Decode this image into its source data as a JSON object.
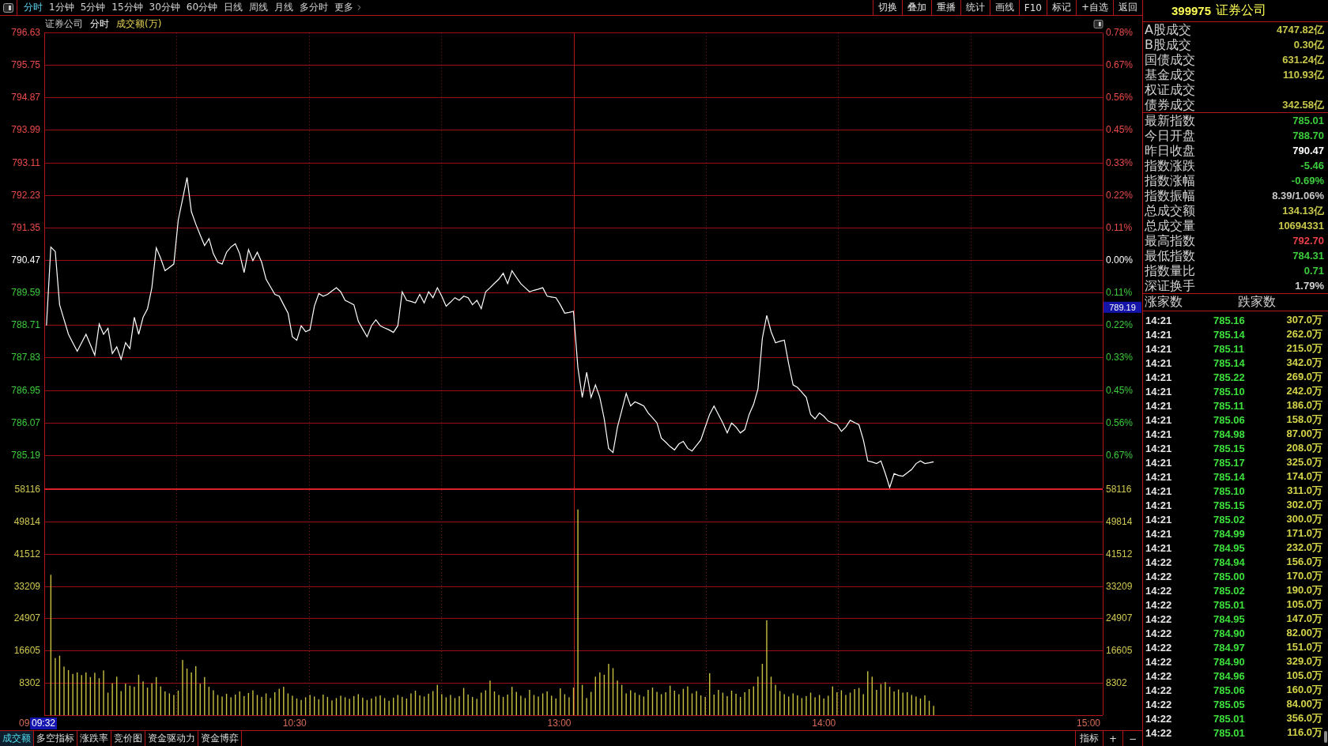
{
  "toolbar": {
    "periods": [
      {
        "label": "分时",
        "selected": true,
        "kind": "period"
      },
      {
        "label": "1分钟",
        "selected": false,
        "kind": "period"
      },
      {
        "label": "5分钟",
        "selected": false,
        "kind": "period"
      },
      {
        "label": "15分钟",
        "selected": false,
        "kind": "period"
      },
      {
        "label": "30分钟",
        "selected": false,
        "kind": "period"
      },
      {
        "label": "60分钟",
        "selected": false,
        "kind": "period"
      },
      {
        "label": "日线",
        "selected": false,
        "kind": "period"
      },
      {
        "label": "周线",
        "selected": false,
        "kind": "period"
      },
      {
        "label": "月线",
        "selected": false,
        "kind": "period"
      },
      {
        "label": "多分时",
        "selected": false,
        "kind": "period"
      },
      {
        "label": "更多",
        "selected": false,
        "kind": "more"
      }
    ],
    "tools": [
      "切换",
      "叠加",
      "重播",
      "统计",
      "画线",
      "F10",
      "标记",
      "+自选",
      "返回"
    ]
  },
  "chart_header": {
    "security": "证券公司",
    "period": "分时",
    "indicator": "成交额(万)"
  },
  "price_chart": {
    "chart_data": {
      "type": "line",
      "grid": true,
      "categories": [
        null,
        null,
        null,
        null,
        null,
        null,
        null,
        null,
        null,
        null,
        null,
        null,
        null,
        null,
        null,
        null,
        null,
        null,
        null,
        null,
        null,
        null,
        null,
        null,
        null,
        null,
        null,
        null,
        null,
        null,
        null,
        null,
        null,
        null,
        null,
        null,
        null,
        null,
        null,
        null,
        null,
        null,
        null,
        null,
        null,
        null,
        null,
        null,
        null,
        null,
        null,
        null,
        null,
        null,
        null,
        null,
        null,
        null,
        null,
        null,
        null,
        null,
        null,
        null,
        null,
        null,
        null,
        null,
        null,
        null,
        null,
        null,
        null,
        null,
        null,
        null,
        null,
        null,
        null,
        null,
        null,
        null,
        null,
        null,
        null,
        null,
        null,
        null,
        null,
        null,
        null,
        null,
        null,
        null,
        null,
        null,
        null,
        null,
        null,
        null,
        null,
        null,
        null,
        null,
        null,
        null,
        null,
        null,
        null,
        null,
        null,
        null,
        null,
        null,
        null,
        null,
        null,
        null,
        null,
        null,
        null,
        null,
        null,
        null,
        null,
        null,
        null,
        null,
        null,
        null,
        null,
        null,
        null,
        null,
        null,
        null,
        null,
        null,
        null,
        null,
        null,
        null,
        null,
        null,
        null,
        null,
        null,
        null,
        null,
        null,
        null,
        null,
        null,
        null,
        null,
        null,
        null,
        null,
        null,
        null,
        null,
        null,
        null,
        null,
        null,
        null,
        null,
        null,
        null,
        null,
        null,
        null,
        null,
        null,
        null,
        null,
        null,
        null,
        null,
        null,
        null,
        null,
        null,
        null,
        null,
        null,
        null,
        null,
        null,
        null,
        null,
        null,
        null,
        null,
        null,
        null,
        null,
        null,
        null,
        null,
        null,
        null,
        null,
        null,
        null,
        null,
        null,
        null,
        null,
        null,
        null,
        null,
        null,
        null,
        null,
        null,
        null,
        null,
        null,
        null,
        null,
        null,
        null,
        null,
        null,
        null,
        null,
        null,
        null,
        null,
        null,
        null,
        null,
        null,
        null,
        null,
        null,
        null,
        null,
        null,
        null
      ],
      "series": [
        {
          "color": "#ffffff",
          "values": [
            788.7,
            790.82,
            790.7,
            789.26,
            788.86,
            788.46,
            788.23,
            788.0,
            788.23,
            788.46,
            788.18,
            787.89,
            788.74,
            788.46,
            788.62,
            787.94,
            788.12,
            787.78,
            788.23,
            788.07,
            788.92,
            788.46,
            788.92,
            789.15,
            789.72,
            790.8,
            790.52,
            790.18,
            790.27,
            790.36,
            791.55,
            792.12,
            792.7,
            791.78,
            791.44,
            791.15,
            790.86,
            791.05,
            790.64,
            790.41,
            790.36,
            790.68,
            790.82,
            790.91,
            790.64,
            790.13,
            790.75,
            790.45,
            790.68,
            790.41,
            789.95,
            789.75,
            789.54,
            789.49,
            789.26,
            789.03,
            788.39,
            788.3,
            788.69,
            788.53,
            788.58,
            789.22,
            789.56,
            789.49,
            789.54,
            789.63,
            789.72,
            789.61,
            789.38,
            789.32,
            789.26,
            788.81,
            788.6,
            788.39,
            788.69,
            788.85,
            788.69,
            788.63,
            788.58,
            788.51,
            788.69,
            789.61,
            789.38,
            789.35,
            789.31,
            789.54,
            789.31,
            789.61,
            789.45,
            789.72,
            789.49,
            789.22,
            789.33,
            789.45,
            789.38,
            789.49,
            789.45,
            789.26,
            789.38,
            789.15,
            789.61,
            789.72,
            789.84,
            789.95,
            790.11,
            789.83,
            790.18,
            790.0,
            789.83,
            789.72,
            789.61,
            789.65,
            789.68,
            789.72,
            789.49,
            789.47,
            789.45,
            789.26,
            789.03,
            789.05,
            789.08,
            787.55,
            786.75,
            787.43,
            786.75,
            787.09,
            786.75,
            786.17,
            785.37,
            785.26,
            785.95,
            786.4,
            786.86,
            786.52,
            786.63,
            786.58,
            786.52,
            786.33,
            786.2,
            786.06,
            785.65,
            785.54,
            785.42,
            785.33,
            785.49,
            785.56,
            785.37,
            785.3,
            785.45,
            785.6,
            785.95,
            786.29,
            786.52,
            786.29,
            786.06,
            785.79,
            786.06,
            785.95,
            785.79,
            785.88,
            786.29,
            786.56,
            786.98,
            788.35,
            788.97,
            788.53,
            788.23,
            788.27,
            788.3,
            787.66,
            787.09,
            787.02,
            786.89,
            786.75,
            786.29,
            786.17,
            786.33,
            786.24,
            786.11,
            786.06,
            786.01,
            785.83,
            785.95,
            786.13,
            786.07,
            786.01,
            785.6,
            785.03,
            785.0,
            784.96,
            785.03,
            784.69,
            784.31,
            784.69,
            784.64,
            784.62,
            784.71,
            784.8,
            784.96,
            785.03,
            784.96,
            784.98,
            785.01,
            null,
            null,
            null,
            null,
            null,
            null,
            null,
            null,
            null,
            null,
            null,
            null,
            null,
            null,
            null,
            null,
            null,
            null,
            null,
            null,
            null,
            null,
            null,
            null,
            null,
            null,
            null,
            null,
            null,
            null,
            null,
            null,
            null,
            null,
            null,
            null,
            null,
            null
          ]
        }
      ],
      "ylim": [
        784.31,
        796.63
      ],
      "yticks": [
        {
          "value": 796.63,
          "label": "796.63"
        },
        {
          "value": 795.75,
          "label": "795.75"
        },
        {
          "value": 794.87,
          "label": "794.87"
        },
        {
          "value": 793.99,
          "label": "793.99"
        },
        {
          "value": 793.11,
          "label": "793.11"
        },
        {
          "value": 792.23,
          "label": "792.23"
        },
        {
          "value": 791.35,
          "label": "791.35"
        },
        {
          "value": 790.47,
          "label": "790.47"
        },
        {
          "value": 789.59,
          "label": "789.59"
        },
        {
          "value": 788.71,
          "label": "788.71"
        },
        {
          "value": 787.83,
          "label": "787.83"
        },
        {
          "value": 786.95,
          "label": "786.95"
        },
        {
          "value": 786.07,
          "label": "786.07"
        },
        {
          "value": 785.19,
          "label": "785.19"
        }
      ]
    },
    "percent_axis": [
      {
        "label": "0.78%",
        "kind": "up"
      },
      {
        "label": "0.67%",
        "kind": "up"
      },
      {
        "label": "0.56%",
        "kind": "up"
      },
      {
        "label": "0.45%",
        "kind": "up"
      },
      {
        "label": "0.33%",
        "kind": "up"
      },
      {
        "label": "0.22%",
        "kind": "up"
      },
      {
        "label": "0.11%",
        "kind": "up"
      },
      {
        "label": "0.00%",
        "kind": "flat"
      },
      {
        "label": "0.11%",
        "kind": "down"
      },
      {
        "label": "0.22%",
        "kind": "down"
      },
      {
        "label": "0.33%",
        "kind": "down"
      },
      {
        "label": "0.45%",
        "kind": "down"
      },
      {
        "label": "0.56%",
        "kind": "down"
      },
      {
        "label": "0.67%",
        "kind": "down"
      }
    ],
    "cursor_price": "789.19"
  },
  "volume_chart": {
    "chart_data": {
      "type": "bar",
      "grid": true,
      "categories": [
        null,
        null,
        null,
        null,
        null,
        null,
        null,
        null,
        null,
        null,
        null,
        null,
        null,
        null,
        null,
        null,
        null,
        null,
        null,
        null,
        null,
        null,
        null,
        null,
        null,
        null,
        null,
        null,
        null,
        null,
        null,
        null,
        null,
        null,
        null,
        null,
        null,
        null,
        null,
        null,
        null,
        null,
        null,
        null,
        null,
        null,
        null,
        null,
        null,
        null,
        null,
        null,
        null,
        null,
        null,
        null,
        null,
        null,
        null,
        null,
        null,
        null,
        null,
        null,
        null,
        null,
        null,
        null,
        null,
        null,
        null,
        null,
        null,
        null,
        null,
        null,
        null,
        null,
        null,
        null,
        null,
        null,
        null,
        null,
        null,
        null,
        null,
        null,
        null,
        null,
        null,
        null,
        null,
        null,
        null,
        null,
        null,
        null,
        null,
        null,
        null,
        null,
        null,
        null,
        null,
        null,
        null,
        null,
        null,
        null,
        null,
        null,
        null,
        null,
        null,
        null,
        null,
        null,
        null,
        null,
        null,
        null,
        null,
        null,
        null,
        null,
        null,
        null,
        null,
        null,
        null,
        null,
        null,
        null,
        null,
        null,
        null,
        null,
        null,
        null,
        null,
        null,
        null,
        null,
        null,
        null,
        null,
        null,
        null,
        null,
        null,
        null,
        null,
        null,
        null,
        null,
        null,
        null,
        null,
        null,
        null,
        null,
        null,
        null,
        null,
        null,
        null,
        null,
        null,
        null,
        null,
        null,
        null,
        null,
        null,
        null,
        null,
        null,
        null,
        null,
        null,
        null,
        null,
        null,
        null,
        null,
        null,
        null,
        null,
        null,
        null,
        null,
        null,
        null,
        null,
        null,
        null,
        null,
        null,
        null,
        null,
        null,
        null,
        null,
        null,
        null,
        null,
        null,
        null,
        null,
        null,
        null,
        null,
        null,
        null,
        null,
        null,
        null,
        null,
        null,
        null,
        null,
        null,
        null,
        null,
        null,
        null,
        null,
        null,
        null,
        null,
        null,
        null,
        null,
        null,
        null,
        null,
        null,
        null,
        null,
        null
      ],
      "series": [
        {
          "color": "#c8c040",
          "values": [
            null,
            36100,
            14700,
            15300,
            12500,
            11600,
            10600,
            11000,
            10300,
            11000,
            9800,
            10900,
            9500,
            11500,
            5800,
            8200,
            9900,
            6200,
            8100,
            7600,
            7300,
            10400,
            8700,
            7100,
            8200,
            9800,
            7400,
            6100,
            5600,
            5200,
            6300,
            14200,
            12000,
            11000,
            12600,
            8100,
            9800,
            7300,
            6400,
            5200,
            4800,
            5500,
            4600,
            5300,
            6100,
            4900,
            5700,
            6400,
            5200,
            4700,
            5600,
            4400,
            5900,
            6800,
            7300,
            5600,
            5000,
            4300,
            3900,
            4600,
            5200,
            4800,
            4100,
            5300,
            4700,
            3800,
            4400,
            5000,
            4600,
            4200,
            4900,
            5400,
            4500,
            3900,
            4300,
            4800,
            5100,
            4400,
            3700,
            4500,
            5200,
            4700,
            4300,
            5600,
            6300,
            5100,
            4800,
            5500,
            6200,
            7800,
            5400,
            4600,
            5200,
            4400,
            4900,
            7000,
            5300,
            4700,
            4200,
            5800,
            6400,
            8900,
            6100,
            5200,
            4700,
            5300,
            7300,
            6000,
            5000,
            4400,
            6500,
            5200,
            4800,
            5600,
            6100,
            5000,
            4300,
            6900,
            5400,
            4600,
            7100,
            52900,
            7800,
            4400,
            6000,
            9900,
            11000,
            10400,
            13200,
            12100,
            8900,
            7800,
            5600,
            6400,
            5800,
            5200,
            4800,
            6500,
            7100,
            6000,
            5400,
            5900,
            7600,
            6300,
            5400,
            6800,
            7400,
            5600,
            6200,
            5100,
            4700,
            10800,
            5300,
            6500,
            5800,
            4900,
            6300,
            5500,
            4700,
            5900,
            6700,
            7400,
            9900,
            13200,
            24400,
            9900,
            7800,
            6200,
            5400,
            4800,
            5600,
            5100,
            4400,
            4900,
            5800,
            4600,
            5200,
            4300,
            5000,
            7400,
            5900,
            6400,
            5200,
            5800,
            6700,
            7000,
            5400,
            11300,
            9900,
            6500,
            8000,
            8500,
            7300,
            6100,
            6600,
            5800,
            5900,
            5200,
            4800,
            4300,
            5100,
            3700,
            2400,
            null,
            null,
            null,
            null,
            null,
            null,
            null,
            null,
            null,
            null,
            null,
            null,
            null,
            null,
            null,
            null,
            null,
            null,
            null,
            null,
            null,
            null,
            null,
            null,
            null,
            null,
            null,
            null,
            null,
            null,
            null,
            null,
            null,
            null,
            null,
            null,
            null,
            null
          ]
        }
      ],
      "ylim": [
        0,
        58116
      ],
      "yticks": [
        {
          "value": 58116,
          "label": "58116"
        },
        {
          "value": 49814,
          "label": "49814"
        },
        {
          "value": 41512,
          "label": "41512"
        },
        {
          "value": 33209,
          "label": "33209"
        },
        {
          "value": 24907,
          "label": "24907"
        },
        {
          "value": 16605,
          "label": "16605"
        },
        {
          "value": 8302,
          "label": "8302"
        }
      ]
    },
    "right_axis": [
      "58116",
      "49814",
      "41512",
      "33209",
      "24907",
      "16605",
      "8302"
    ]
  },
  "time_axis": {
    "labels": [
      "09",
      "10:30",
      "13:00",
      "14:00",
      "15:00"
    ],
    "cursor": "09:32"
  },
  "bottom_tabs": [
    {
      "label": "成交额",
      "selected": true
    },
    {
      "label": "多空指标",
      "selected": false
    },
    {
      "label": "涨跌率",
      "selected": false
    },
    {
      "label": "竞价图",
      "selected": false
    },
    {
      "label": "资金驱动力",
      "selected": false
    },
    {
      "label": "资金博弈",
      "selected": false
    }
  ],
  "bottom_tools": [
    "指标",
    "+",
    "−"
  ],
  "quote_panel": {
    "code": "399975",
    "name": "证券公司",
    "turnover": [
      {
        "label": "A股成交",
        "value": "4747.82亿"
      },
      {
        "label": "B股成交",
        "value": "0.30亿"
      },
      {
        "label": "国债成交",
        "value": "631.24亿"
      },
      {
        "label": "基金成交",
        "value": "110.93亿"
      },
      {
        "label": "权证成交"
      },
      {
        "label": "债券成交",
        "value": "342.58亿"
      }
    ],
    "stats": [
      {
        "label": "最新指数",
        "value": "785.01",
        "color": "#3ccc3c"
      },
      {
        "label": "今日开盘",
        "value": "788.70",
        "color": "#3ccc3c"
      },
      {
        "label": "昨日收盘",
        "value": "790.47",
        "color": "#ffffff"
      },
      {
        "label": "指数涨跌",
        "value": "-5.46",
        "color": "#3ccc3c"
      },
      {
        "label": "指数涨幅",
        "value": "-0.69%",
        "color": "#3ccc3c"
      },
      {
        "label": "指数振幅",
        "value": "8.39/1.06%",
        "color": "#c8c8c8"
      },
      {
        "label": "总成交额",
        "value": "134.13亿",
        "color": "#c8c84a"
      },
      {
        "label": "总成交量",
        "value": "10694331",
        "color": "#c8c84a"
      },
      {
        "label": "最高指数",
        "value": "792.70",
        "color": "#e8404a"
      },
      {
        "label": "最低指数",
        "value": "784.31",
        "color": "#3ccc3c"
      },
      {
        "label": "指数量比",
        "value": "0.71",
        "color": "#3ccc3c"
      },
      {
        "label": "深证换手",
        "value": "1.79%",
        "color": "#d0d0d0"
      }
    ],
    "breadth": [
      "涨家数",
      "跌家数"
    ],
    "ticks": [
      {
        "time": "14:21",
        "price": "785.16",
        "volume": "307.0万"
      },
      {
        "time": "14:21",
        "price": "785.14",
        "volume": "262.0万"
      },
      {
        "time": "14:21",
        "price": "785.11",
        "volume": "215.0万"
      },
      {
        "time": "14:21",
        "price": "785.14",
        "volume": "342.0万"
      },
      {
        "time": "14:21",
        "price": "785.22",
        "volume": "269.0万"
      },
      {
        "time": "14:21",
        "price": "785.10",
        "volume": "242.0万"
      },
      {
        "time": "14:21",
        "price": "785.11",
        "volume": "186.0万"
      },
      {
        "time": "14:21",
        "price": "785.06",
        "volume": "158.0万"
      },
      {
        "time": "14:21",
        "price": "784.98",
        "volume": "87.00万"
      },
      {
        "time": "14:21",
        "price": "785.15",
        "volume": "208.0万"
      },
      {
        "time": "14:21",
        "price": "785.17",
        "volume": "325.0万"
      },
      {
        "time": "14:21",
        "price": "785.14",
        "volume": "174.0万"
      },
      {
        "time": "14:21",
        "price": "785.10",
        "volume": "311.0万"
      },
      {
        "time": "14:21",
        "price": "785.15",
        "volume": "302.0万"
      },
      {
        "time": "14:21",
        "price": "785.02",
        "volume": "300.0万"
      },
      {
        "time": "14:21",
        "price": "784.99",
        "volume": "171.0万"
      },
      {
        "time": "14:21",
        "price": "784.95",
        "volume": "232.0万"
      },
      {
        "time": "14:22",
        "price": "784.94",
        "volume": "156.0万"
      },
      {
        "time": "14:22",
        "price": "785.00",
        "volume": "170.0万"
      },
      {
        "time": "14:22",
        "price": "785.02",
        "volume": "190.0万"
      },
      {
        "time": "14:22",
        "price": "785.01",
        "volume": "105.0万"
      },
      {
        "time": "14:22",
        "price": "784.95",
        "volume": "147.0万"
      },
      {
        "time": "14:22",
        "price": "784.90",
        "volume": "82.00万"
      },
      {
        "time": "14:22",
        "price": "784.97",
        "volume": "151.0万"
      },
      {
        "time": "14:22",
        "price": "784.90",
        "volume": "329.0万"
      },
      {
        "time": "14:22",
        "price": "784.96",
        "volume": "105.0万"
      },
      {
        "time": "14:22",
        "price": "785.06",
        "volume": "160.0万"
      },
      {
        "time": "14:22",
        "price": "785.05",
        "volume": "84.00万"
      },
      {
        "time": "14:22",
        "price": "785.01",
        "volume": "356.0万"
      },
      {
        "time": "14:22",
        "price": "785.01",
        "volume": "116.0万"
      }
    ]
  }
}
